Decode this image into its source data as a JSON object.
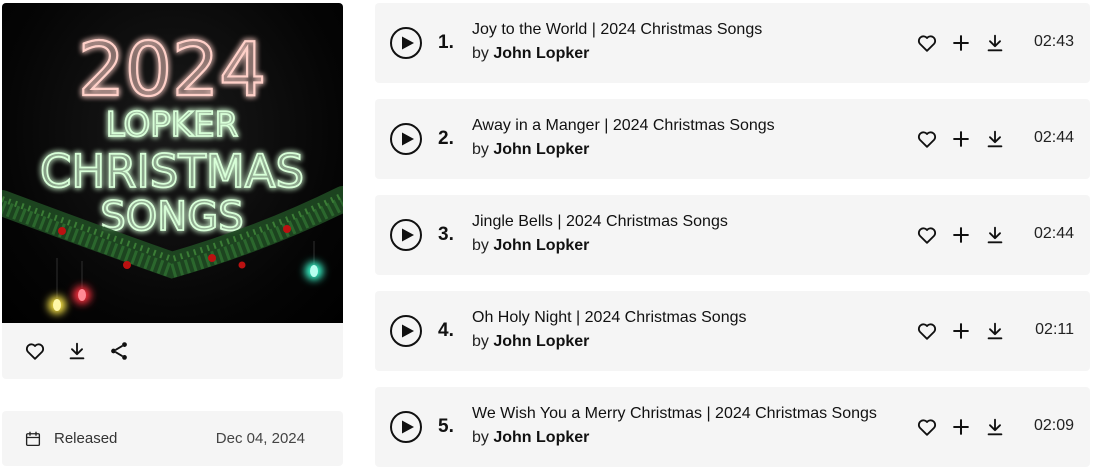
{
  "album": {
    "cover": {
      "line1": "2024",
      "line2": "LOPKER",
      "line3": "CHRISTMAS",
      "line4": "SONGS",
      "neon_red": "#ff2a2a",
      "neon_green": "#3dff5a"
    },
    "actions": [
      {
        "name": "like-button",
        "icon": "heart-icon"
      },
      {
        "name": "download-button",
        "icon": "download-icon"
      },
      {
        "name": "share-button",
        "icon": "share-icon"
      }
    ],
    "release": {
      "icon": "calendar-icon",
      "label": "Released",
      "date": "Dec 04, 2024"
    }
  },
  "tracks": [
    {
      "number": "1.",
      "title": "Joy to the World | 2024 Christmas Songs",
      "by": "by",
      "artist": "John Lopker",
      "duration": "02:43"
    },
    {
      "number": "2.",
      "title": "Away in a Manger | 2024 Christmas Songs",
      "by": "by",
      "artist": "John Lopker",
      "duration": "02:44"
    },
    {
      "number": "3.",
      "title": "Jingle Bells | 2024 Christmas Songs",
      "by": "by",
      "artist": "John Lopker",
      "duration": "02:44"
    },
    {
      "number": "4.",
      "title": "Oh Holy Night | 2024 Christmas Songs",
      "by": "by",
      "artist": "John Lopker",
      "duration": "02:11"
    },
    {
      "number": "5.",
      "title": "We Wish You a Merry Christmas | 2024 Christmas Songs",
      "by": "by",
      "artist": "John Lopker",
      "duration": "02:09"
    }
  ],
  "colors": {
    "card_bg": "#f5f5f5",
    "text": "#111111"
  }
}
